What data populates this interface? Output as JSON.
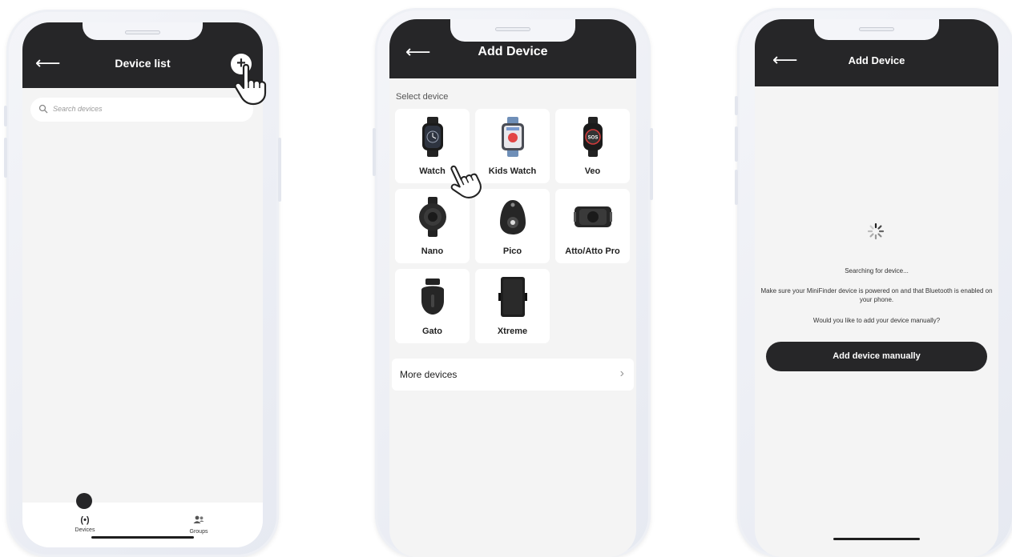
{
  "phone1": {
    "title": "Device list",
    "back_icon": "back-arrow-icon",
    "add_icon": "plus-icon",
    "add_glyph": "+",
    "search": {
      "placeholder": "Search devices",
      "icon": "search-icon"
    },
    "nav": [
      {
        "label": "Devices",
        "icon": "devices-icon",
        "glyph": "(•)"
      },
      {
        "label": "Groups",
        "icon": "groups-icon",
        "glyph": "👥"
      }
    ]
  },
  "phone2": {
    "title": "Add Device",
    "back_icon": "back-arrow-icon",
    "section_label": "Select device",
    "devices": [
      {
        "label": "Watch",
        "icon": "smartwatch-icon"
      },
      {
        "label": "Kids Watch",
        "icon": "kids-watch-icon"
      },
      {
        "label": "Veo",
        "icon": "veo-watch-icon"
      },
      {
        "label": "Nano",
        "icon": "nano-tracker-icon"
      },
      {
        "label": "Pico",
        "icon": "pico-tracker-icon"
      },
      {
        "label": "Atto/Atto Pro",
        "icon": "atto-tracker-icon"
      },
      {
        "label": "Gato",
        "icon": "gato-tracker-icon"
      },
      {
        "label": "Xtreme",
        "icon": "xtreme-tracker-icon"
      }
    ],
    "more_devices": "More devices",
    "chevron": "›"
  },
  "phone3": {
    "title": "Add Device",
    "back_icon": "back-arrow-icon",
    "spinner_icon": "loading-spinner-icon",
    "searching": "Searching for device...",
    "hint": "Make sure your MiniFinder device is powered on and that Bluetooth is enabled on your phone.",
    "question": "Would you like to add your device manually?",
    "button": "Add device manually"
  },
  "colors": {
    "header_bg": "#262628",
    "screen_bg": "#f4f4f4",
    "card_bg": "#ffffff",
    "button_bg": "#262628"
  },
  "hand_icon": "pointing-hand-icon",
  "back_glyph": "⟵"
}
